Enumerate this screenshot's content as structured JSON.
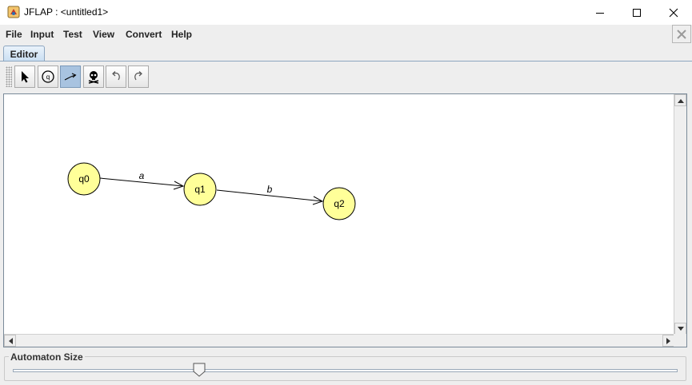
{
  "window": {
    "title": "JFLAP : <untitled1>"
  },
  "menu": {
    "items": [
      "File",
      "Input",
      "Test",
      "View",
      "Convert",
      "Help"
    ]
  },
  "tabs": [
    {
      "label": "Editor",
      "selected": true
    }
  ],
  "toolbar": {
    "tools": [
      {
        "name": "attribute-editor",
        "icon": "arrow-pointer-icon",
        "selected": false
      },
      {
        "name": "state-creator",
        "icon": "state-circle-icon",
        "selected": false
      },
      {
        "name": "transition-creator",
        "icon": "transition-arrow-icon",
        "selected": true
      },
      {
        "name": "deleter",
        "icon": "skull-icon",
        "selected": false
      },
      {
        "name": "undo",
        "icon": "undo-icon",
        "selected": false
      },
      {
        "name": "redo",
        "icon": "redo-icon",
        "selected": false
      }
    ]
  },
  "automaton": {
    "states": [
      {
        "label": "q0"
      },
      {
        "label": "q1"
      },
      {
        "label": "q2"
      }
    ],
    "transitions": [
      {
        "from": "q0",
        "to": "q1",
        "label": "a"
      },
      {
        "from": "q1",
        "to": "q2",
        "label": "b"
      }
    ],
    "state_color": "#ffff99"
  },
  "size_panel": {
    "label": "Automaton Size",
    "value_percent": 28
  }
}
